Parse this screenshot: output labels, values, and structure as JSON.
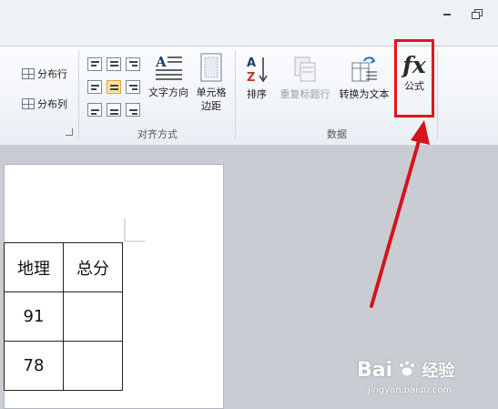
{
  "window": {
    "minimize_icon": "minimize-icon",
    "restore_icon": "restore-icon"
  },
  "ribbon": {
    "rows_cols": {
      "distribute_rows": "分布行",
      "distribute_cols": "分布列"
    },
    "alignment": {
      "label": "对齐方式",
      "text_direction": "文字方向",
      "cell_margins_line1": "单元格",
      "cell_margins_line2": "边距"
    },
    "data": {
      "label": "数据",
      "sort": "排序",
      "repeat_header": "重复标题行",
      "convert_to_text": "转换为文本",
      "formula": "公式",
      "formula_icon_text": "fx"
    }
  },
  "table": {
    "headers": [
      "地理",
      "总分"
    ],
    "rows": [
      [
        "91",
        ""
      ],
      [
        "78",
        ""
      ]
    ]
  },
  "watermark": {
    "brand": "Bai",
    "brand2": "经验",
    "url": "jingyan.baidu.com"
  },
  "colors": {
    "highlight": "#e4141e",
    "active_align": "#fde59a"
  }
}
